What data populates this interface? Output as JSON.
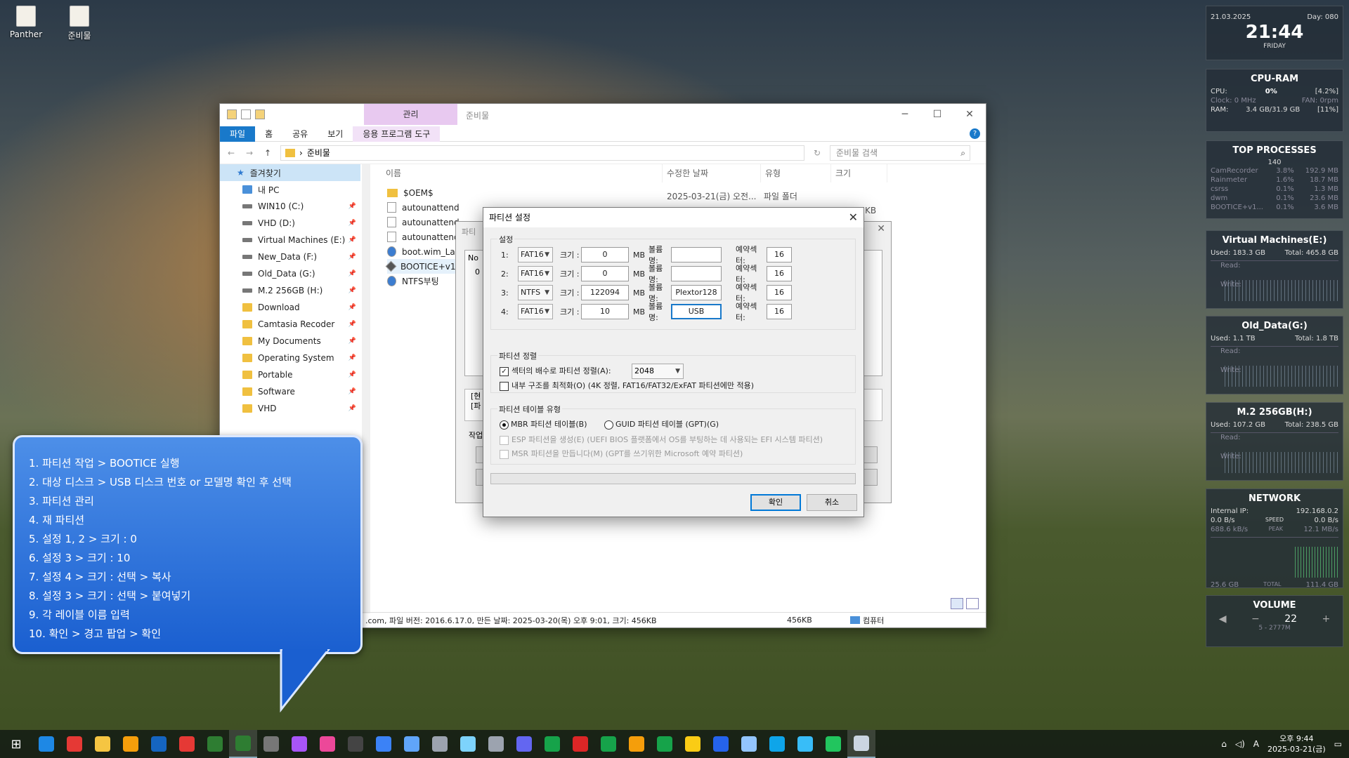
{
  "desktop": {
    "icons": [
      "Panther",
      "준비물"
    ]
  },
  "explorer": {
    "context_tab": "관리",
    "title": "준비물",
    "ribbon_tabs": [
      "파일",
      "홈",
      "공유",
      "보기",
      "응용 프로그램 도구"
    ],
    "path": "준비물",
    "search_placeholder": "준비물 검색",
    "nav_items": [
      {
        "label": "즐겨찾기",
        "type": "star"
      },
      {
        "label": "내 PC",
        "type": "pc"
      },
      {
        "label": "WIN10 (C:)",
        "type": "drive"
      },
      {
        "label": "VHD (D:)",
        "type": "drive"
      },
      {
        "label": "Virtual Machines (E:)",
        "type": "drive"
      },
      {
        "label": "New_Data (F:)",
        "type": "drive"
      },
      {
        "label": "Old_Data (G:)",
        "type": "drive"
      },
      {
        "label": "M.2 256GB (H:)",
        "type": "drive"
      },
      {
        "label": "Download",
        "type": "folder"
      },
      {
        "label": "Camtasia Recoder",
        "type": "folder"
      },
      {
        "label": "My Documents",
        "type": "folder"
      },
      {
        "label": "Operating System",
        "type": "folder"
      },
      {
        "label": "Portable",
        "type": "folder"
      },
      {
        "label": "Software",
        "type": "folder"
      },
      {
        "label": "VHD",
        "type": "folder"
      }
    ],
    "columns": [
      "이름",
      "수정한 날짜",
      "유형",
      "크기"
    ],
    "files": [
      {
        "name": "$OEM$",
        "type": "folder"
      },
      {
        "name": "autounattend",
        "type": "file"
      },
      {
        "name": "autounattend_",
        "type": "file"
      },
      {
        "name": "autounattend_",
        "type": "file"
      },
      {
        "name": "boot.wim_Lau",
        "type": "blue"
      },
      {
        "name": "BOOTICE+v1.3",
        "type": "app"
      },
      {
        "name": "NTFS부팅",
        "type": "blue"
      }
    ],
    "first_row_date": "2025-03-21(금) 오전...",
    "first_row_type": "파일 폴더",
    "partial_size": "KB",
    "status_text": ".com, 파일 버전: 2016.6.17.0, 만든 날짜: 2025-03-20(목) 오후 9:01, 크기: 456KB",
    "status_size": "456KB",
    "status_location": "컴퓨터"
  },
  "bg_dialog": {
    "title_partial": "파티",
    "col_no": "No",
    "row0": "0",
    "text1": "[현",
    "text2": "[파",
    "label": "작업"
  },
  "dialog": {
    "title": "파티션 설정",
    "settings_label": "설정",
    "size_label": "크기 :",
    "unit": "MB",
    "volume_label": "볼륨명:",
    "reserved_label": "예약섹터:",
    "partitions": [
      {
        "num": "1:",
        "fs": "FAT16",
        "size": "0",
        "volume": "",
        "reserved": "16"
      },
      {
        "num": "2:",
        "fs": "FAT16",
        "size": "0",
        "volume": "",
        "reserved": "16"
      },
      {
        "num": "3:",
        "fs": "NTFS",
        "size": "122094",
        "volume": "Plextor128",
        "reserved": "16"
      },
      {
        "num": "4:",
        "fs": "FAT16",
        "size": "10",
        "volume": "USB",
        "reserved": "16"
      }
    ],
    "align_group": "파티션 정렬",
    "align_option": "섹터의 배수로 파티션 정렬(A):",
    "align_value": "2048",
    "optimize_option": "내부 구조를 최적화(O) (4K 정렬, FAT16/FAT32/ExFAT 파티션에만 적용)",
    "table_group": "파티션 테이블 유형",
    "mbr_option": "MBR 파티션 테이블(B)",
    "gpt_option": "GUID 파티션 테이블 (GPT)(G)",
    "esp_option": "ESP 파티션을 생성(E) (UEFI BIOS 플랫폼에서 OS를 부팅하는 데 사용되는 EFI 시스템 파티션)",
    "msr_option": "MSR 파티션을 만듭니다(M) (GPT를 쓰기위한 Microsoft 예약 파티션)",
    "ok": "확인",
    "cancel": "취소"
  },
  "callout": {
    "steps": [
      "1. 파티션 작업 > BOOTICE 실행",
      "2. 대상 디스크 > USB 디스크 번호 or 모델명 확인 후 선택",
      "3. 파티션 관리",
      "4. 재 파티션",
      "5. 설정 1, 2 > 크기 : 0",
      "6. 설정 3 > 크기 : 10",
      "7. 설정 4 > 크기 : 선택 > 복사",
      "8. 설정 3 > 크기 : 선택 > 붙여넣기",
      "9. 각 레이블 이름 입력",
      "10. 확인 > 경고 팝업 > 확인"
    ]
  },
  "widgets": {
    "clock": {
      "date": "21.03.2025",
      "day": "Day: 080",
      "time": "21:44",
      "weekday": "FRIDAY"
    },
    "cpu_ram": {
      "title": "CPU-RAM",
      "cpu_label": "CPU:",
      "cpu_value": "0%",
      "cpu_pct": "[4.2%]",
      "clock_label": "Clock: 0 MHz",
      "fan": "FAN: 0rpm",
      "ram_label": "RAM:",
      "ram_value": "3.4 GB/31.9 GB",
      "ram_pct": "[11%]"
    },
    "processes": {
      "title": "TOP PROCESSES",
      "count": "140",
      "rows": [
        {
          "name": "CamRecorder",
          "cpu": "3.8%",
          "mem": "192.9 MB"
        },
        {
          "name": "Rainmeter",
          "cpu": "1.6%",
          "mem": "18.7 MB"
        },
        {
          "name": "csrss",
          "cpu": "0.1%",
          "mem": "1.3 MB"
        },
        {
          "name": "dwm",
          "cpu": "0.1%",
          "mem": "23.6 MB"
        },
        {
          "name": "BOOTICE+v1...",
          "cpu": "0.1%",
          "mem": "3.6 MB"
        }
      ]
    },
    "disks": [
      {
        "title": "Virtual Machines(E:)",
        "used": "Used: 183.3 GB",
        "total": "Total: 465.8 GB"
      },
      {
        "title": "Old_Data(G:)",
        "used": "Used: 1.1 TB",
        "total": "Total: 1.8 TB"
      },
      {
        "title": "M.2 256GB(H:)",
        "used": "Used: 107.2 GB",
        "total": "Total: 238.5 GB"
      }
    ],
    "read_label": "Read:",
    "write_label": "Write:",
    "network": {
      "title": "NETWORK",
      "ip_label": "Internal IP:",
      "ip": "192.168.0.2",
      "down": "0.0 B/s",
      "speed": "SPEED",
      "up": "0.0 B/s",
      "peak_down": "688.6 kB/s",
      "peak": "PEAK",
      "peak_up": "12.1 MB/s",
      "total_down": "25.6 GB",
      "total": "TOTAL",
      "total_up": "111.4 GB"
    },
    "volume": {
      "title": "VOLUME",
      "value": "22",
      "sub": "5 - 2777M"
    }
  },
  "taskbar": {
    "icon_colors": [
      "#1e88e5",
      "#e53935",
      "#f5c542",
      "#f59e0b",
      "#1565c0",
      "#e53935",
      "#2e7d32",
      "#2e7d32",
      "#777777",
      "#a855f7",
      "#ec4899",
      "#444444",
      "#3b82f6",
      "#60a5fa",
      "#9ca3af",
      "#7dd3fc",
      "#9ca3af",
      "#6366f1",
      "#16a34a",
      "#dc2626",
      "#16a34a",
      "#f59e0b",
      "#16a34a",
      "#facc15",
      "#2563eb",
      "#93c5fd",
      "#0ea5e9",
      "#38bdf8",
      "#22c55e",
      "#cbd5e1"
    ],
    "time_period": "오후 9:44",
    "date": "2025-03-21(금)"
  }
}
